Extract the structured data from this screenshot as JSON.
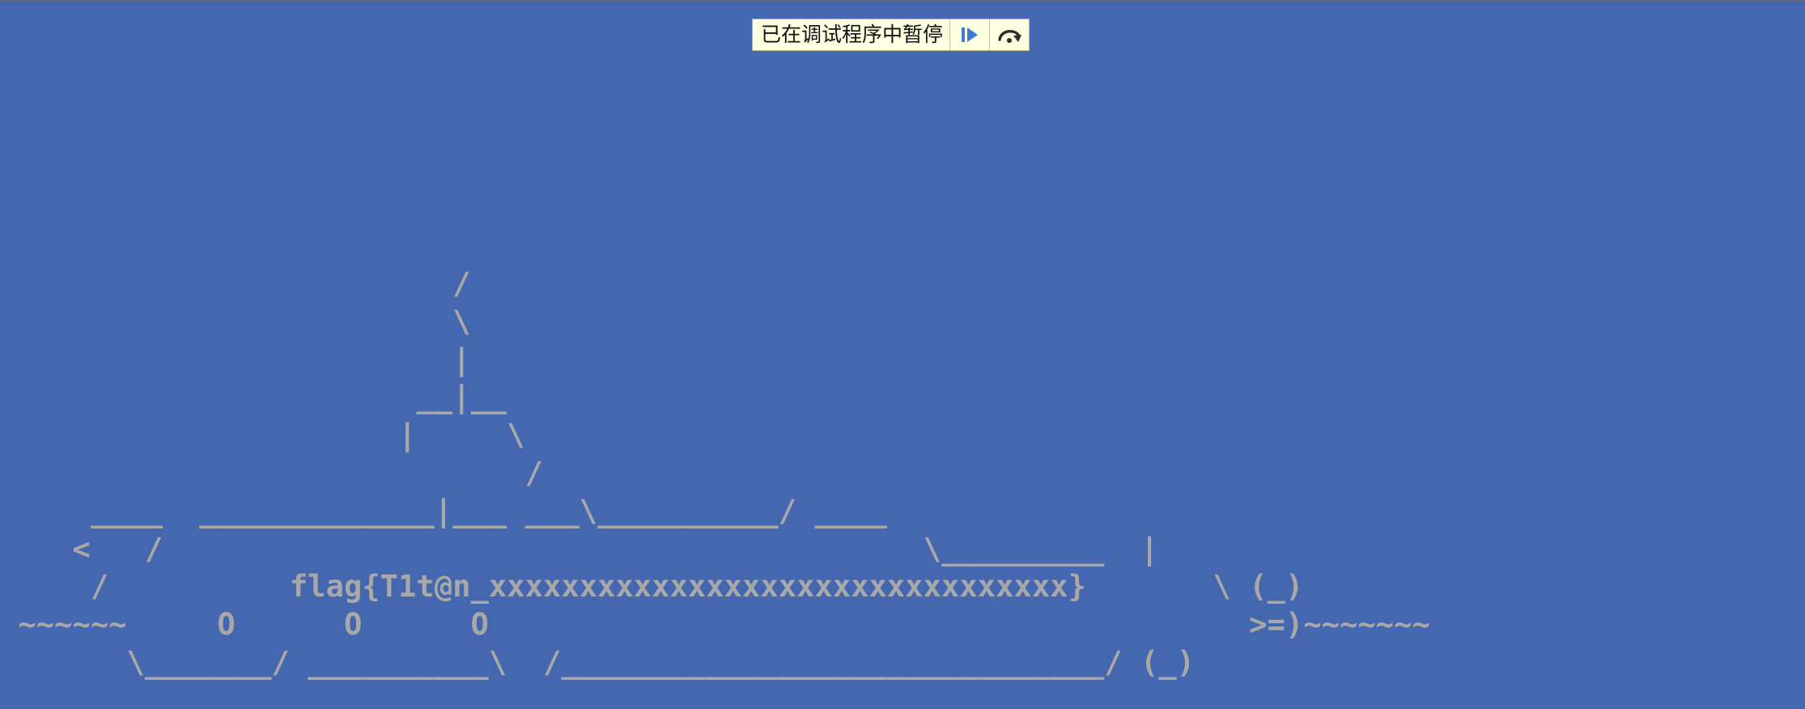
{
  "debugger": {
    "paused_label": "已在调试程序中暂停",
    "resume_icon": "resume-play-icon",
    "step_over_icon": "step-over-icon",
    "bar_color": "#FFFFE1"
  },
  "background_color": "#4467B0",
  "text_color": "#A8A8A8",
  "ascii_art": [
    "                         /",
    "                         \\",
    "                         |",
    "                       __|__",
    "                      |     \\",
    "                             /",
    "     ____  _____________|___ ___\\__________/ ____",
    "    <   /                                          \\_________  |",
    "     /          flag{T1t@n_xxxxxxxxxxxxxxxxxxxxxxxxxxxxxxxx}       \\ (_)",
    " ~~~~~~     O      O      O                                          >=)~~~~~~~",
    "       \\_______/ __________\\  /______________________________/ (_)"
  ]
}
